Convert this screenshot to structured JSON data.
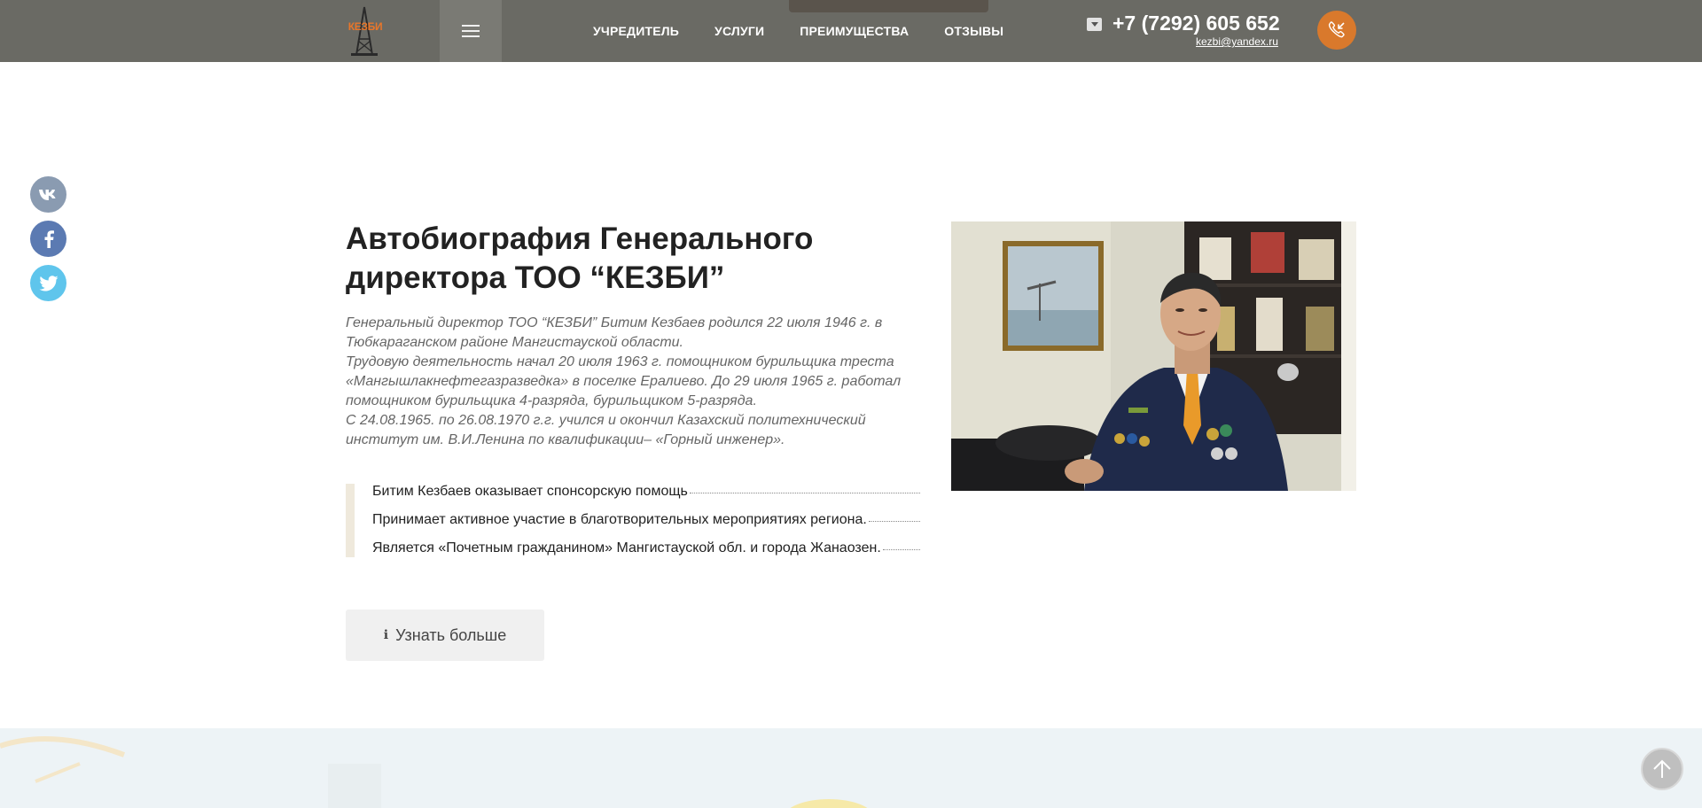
{
  "header": {
    "logo_text": "КЕЗБИ",
    "nav": [
      "УЧРЕДИТЕЛЬ",
      "УСЛУГИ",
      "ПРЕИМУЩЕСТВА",
      "ОТЗЫВЫ"
    ],
    "phone": "+7 (7292) 605 652",
    "email": "kezbi@yandex.ru"
  },
  "main": {
    "title_line1": "Автобиография Генерального",
    "title_line2": "директора ТОО “КЕЗБИ”",
    "intro": [
      "Генеральный директор ТОО “КЕЗБИ” Битим Кезбаев родился 22 июля 1946 г. в Тюбкараганском районе Мангистауской области.",
      "Трудовую деятельность начал 20 июля 1963 г. помощником бурильщика треста «Мангышлакнефтегазразведка» в поселке Ералиево. До 29 июля 1965 г. работал помощником бурильщика 4-разряда, бурильщиком 5-разряда.",
      "С 24.08.1965. по 26.08.1970 г.г. учился и окончил Казахский политехнический институт им. В.И.Ленина по квалификации– «Горный инженер»."
    ],
    "bullets": [
      "Битим Кезбаев оказывает спонсорскую помощь",
      "Принимает активное участие в благотворительных мероприятиях региона.",
      "Является «Почетным гражданином» Мангистауской обл. и города Жанаозен."
    ],
    "more_button": "Узнать больше",
    "more_icon": "info-icon"
  },
  "social": [
    "vk-icon",
    "facebook-icon",
    "twitter-icon"
  ],
  "colors": {
    "header_bg": "#6a6a64",
    "accent": "#d9792c",
    "bullet_bar": "#efe9dc",
    "vk": "#8a9bb1",
    "facebook": "#5b7ab2",
    "twitter": "#5fc5ec"
  }
}
